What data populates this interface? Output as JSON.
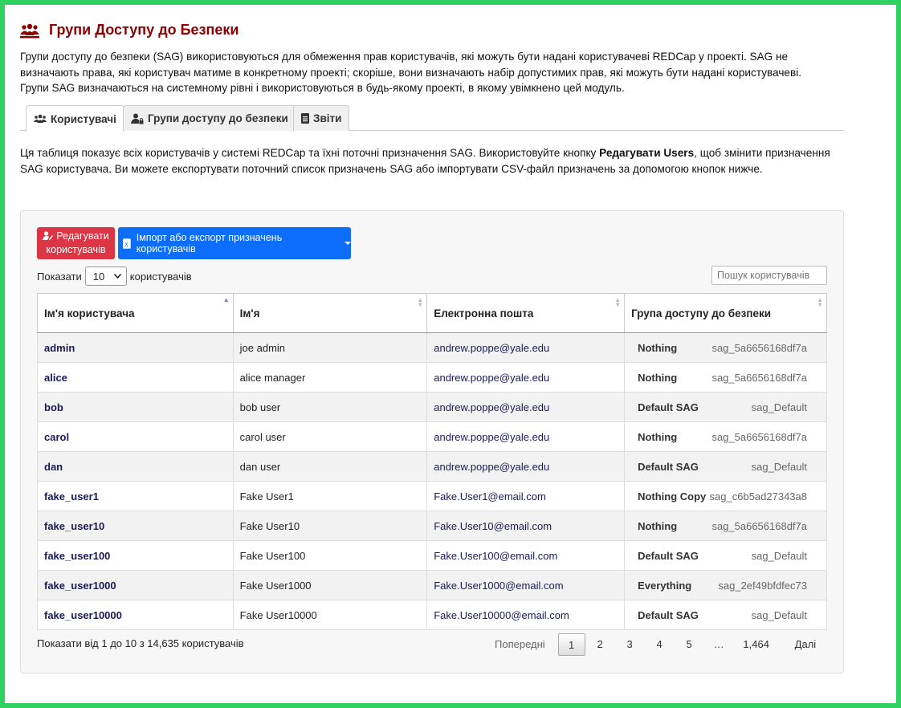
{
  "header": {
    "title": "Групи Доступу до Безпеки",
    "intro": "Групи доступу до безпеки (SAG) використовуються для обмеження прав користувачів, які можуть бути надані користувачеві REDCap у проекті. SAG не визначають права, які користувач матиме в конкретному проекті; скоріше, вони визначають набір допустимих прав, які можуть бути надані користувачеві. Групи SAG визначаються на системному рівні і використовуються в будь-якому проекті, в якому увімкнено цей модуль."
  },
  "tabs": [
    {
      "label": "Користувачі",
      "icon": "users-icon"
    },
    {
      "label": "Групи доступу до безпеки",
      "icon": "user-lock-icon"
    },
    {
      "label": "Звіти",
      "icon": "document-icon"
    }
  ],
  "description": {
    "part1": "Ця таблиця показує всіх користувачів у системі REDCap та їхні поточні призначення SAG. Використовуйте кнопку ",
    "bold": "Редагувати Users",
    "part2": ", щоб змінити призначення SAG користувача. Ви можете експортувати поточний список призначень SAG або імпортувати CSV-файл призначень за допомогою кнопок нижче."
  },
  "toolbar": {
    "edit_label_1": "Редагувати",
    "edit_label_2": "користувачів",
    "import_label": "Імпорт або експорт призначень користувачів"
  },
  "length": {
    "show": "Показати",
    "value": "10",
    "suffix": "користувачів"
  },
  "search": {
    "placeholder": "Пошук користувачів"
  },
  "table": {
    "columns": [
      "Ім'я користувача",
      "Ім'я",
      "Електронна пошта",
      "Група доступу до безпеки"
    ],
    "rows": [
      {
        "username": "admin",
        "name": "joe admin",
        "email": "andrew.poppe@yale.edu",
        "sag": "Nothing",
        "sag_id": "sag_5a6656168df7a"
      },
      {
        "username": "alice",
        "name": "alice manager",
        "email": "andrew.poppe@yale.edu",
        "sag": "Nothing",
        "sag_id": "sag_5a6656168df7a"
      },
      {
        "username": "bob",
        "name": "bob user",
        "email": "andrew.poppe@yale.edu",
        "sag": "Default SAG",
        "sag_id": "sag_Default"
      },
      {
        "username": "carol",
        "name": "carol user",
        "email": "andrew.poppe@yale.edu",
        "sag": "Nothing",
        "sag_id": "sag_5a6656168df7a"
      },
      {
        "username": "dan",
        "name": "dan user",
        "email": "andrew.poppe@yale.edu",
        "sag": "Default SAG",
        "sag_id": "sag_Default"
      },
      {
        "username": "fake_user1",
        "name": "Fake User1",
        "email": "Fake.User1@email.com",
        "sag": "Nothing Copy",
        "sag_id": "sag_c6b5ad27343a8"
      },
      {
        "username": "fake_user10",
        "name": "Fake User10",
        "email": "Fake.User10@email.com",
        "sag": "Nothing",
        "sag_id": "sag_5a6656168df7a"
      },
      {
        "username": "fake_user100",
        "name": "Fake User100",
        "email": "Fake.User100@email.com",
        "sag": "Default SAG",
        "sag_id": "sag_Default"
      },
      {
        "username": "fake_user1000",
        "name": "Fake User1000",
        "email": "Fake.User1000@email.com",
        "sag": "Everything",
        "sag_id": "sag_2ef49bfdfec73"
      },
      {
        "username": "fake_user10000",
        "name": "Fake User10000",
        "email": "Fake.User10000@email.com",
        "sag": "Default SAG",
        "sag_id": "sag_Default"
      }
    ]
  },
  "footer": {
    "info": "Показати від 1 до 10 з 14,635 користувачів",
    "prev": "Попередні",
    "pages": [
      "1",
      "2",
      "3",
      "4",
      "5",
      "…",
      "1,464"
    ],
    "next": "Далі"
  },
  "colors": {
    "title": "#8b0000",
    "danger": "#dc3545",
    "primary": "#0d6efd",
    "frame": "#2fd160"
  }
}
